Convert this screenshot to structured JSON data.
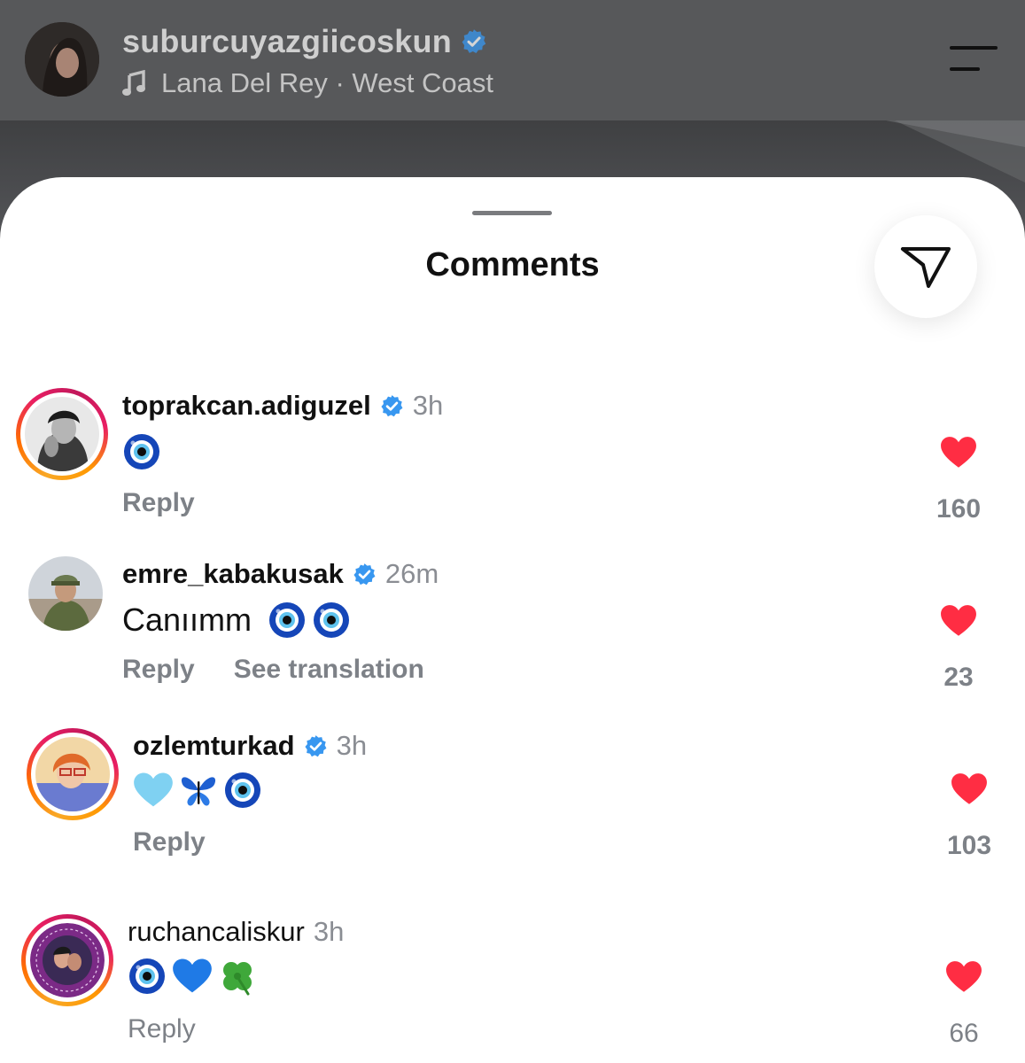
{
  "header": {
    "username": "suburcuyazgiicoskun",
    "music": "Lana Del Rey · West Coast"
  },
  "sheet": {
    "title": "Comments"
  },
  "comments": [
    {
      "username": "toprakcan.adiguzel",
      "verified": true,
      "time": "3h",
      "text": "",
      "emojis": [
        "nazar-amulet"
      ],
      "actions": [
        "Reply"
      ],
      "likes": "160",
      "story_ring": true
    },
    {
      "username": "emre_kabakusak",
      "verified": true,
      "time": "26m",
      "text": "Canıımm",
      "emojis": [
        "nazar-amulet",
        "nazar-amulet"
      ],
      "actions": [
        "Reply",
        "See translation"
      ],
      "likes": "23",
      "story_ring": false
    },
    {
      "username": "ozlemturkad",
      "verified": true,
      "time": "3h",
      "text": "",
      "emojis": [
        "light-blue-heart",
        "butterfly",
        "nazar-amulet"
      ],
      "actions": [
        "Reply"
      ],
      "likes": "103",
      "story_ring": true
    },
    {
      "username": "ruchancaliskur",
      "verified": false,
      "time": "3h",
      "text": "",
      "emojis": [
        "nazar-amulet",
        "blue-heart",
        "four-leaf-clover"
      ],
      "actions": [
        "Reply"
      ],
      "likes": "66",
      "story_ring": true
    }
  ],
  "colors": {
    "like_red": "#ff2d43",
    "verified_blue": "#3897f0",
    "muted_text": "#7d8187"
  }
}
